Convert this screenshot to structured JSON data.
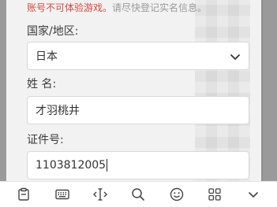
{
  "notice": {
    "warning_text": "账号不可体验游戏。",
    "hint_text": "请尽快登记实名信息。"
  },
  "form": {
    "country_label": "国家/地区:",
    "country_value": "日本",
    "name_label": "姓  名:",
    "name_value": "才羽桃井",
    "id_label": "证件号:",
    "id_value": "1103812005"
  },
  "toolbar": {
    "icons": [
      "clipboard-icon",
      "keyboard-icon",
      "text-cursor-icon",
      "search-icon",
      "emoji-icon",
      "apps-grid-icon",
      "collapse-chevron-icon"
    ]
  },
  "colors": {
    "warning": "#d7493f",
    "hint": "#9a9a9a"
  }
}
